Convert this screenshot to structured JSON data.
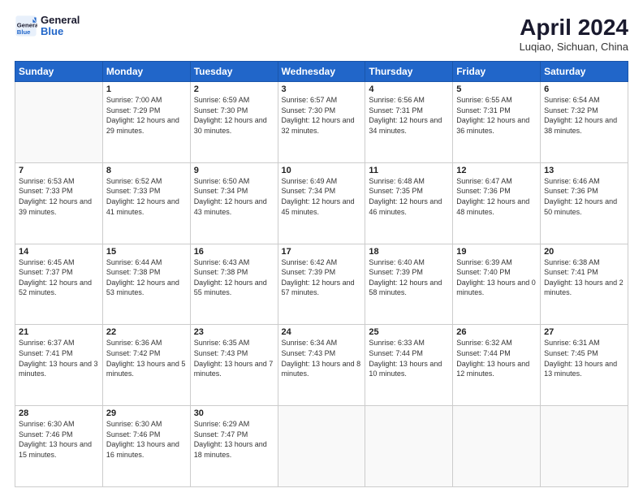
{
  "header": {
    "logo_line1": "General",
    "logo_line2": "Blue",
    "title": "April 2024",
    "subtitle": "Luqiao, Sichuan, China"
  },
  "weekdays": [
    "Sunday",
    "Monday",
    "Tuesday",
    "Wednesday",
    "Thursday",
    "Friday",
    "Saturday"
  ],
  "weeks": [
    [
      {
        "day": "",
        "sunrise": "",
        "sunset": "",
        "daylight": ""
      },
      {
        "day": "1",
        "sunrise": "7:00 AM",
        "sunset": "7:29 PM",
        "daylight": "12 hours and 29 minutes."
      },
      {
        "day": "2",
        "sunrise": "6:59 AM",
        "sunset": "7:30 PM",
        "daylight": "12 hours and 30 minutes."
      },
      {
        "day": "3",
        "sunrise": "6:57 AM",
        "sunset": "7:30 PM",
        "daylight": "12 hours and 32 minutes."
      },
      {
        "day": "4",
        "sunrise": "6:56 AM",
        "sunset": "7:31 PM",
        "daylight": "12 hours and 34 minutes."
      },
      {
        "day": "5",
        "sunrise": "6:55 AM",
        "sunset": "7:31 PM",
        "daylight": "12 hours and 36 minutes."
      },
      {
        "day": "6",
        "sunrise": "6:54 AM",
        "sunset": "7:32 PM",
        "daylight": "12 hours and 38 minutes."
      }
    ],
    [
      {
        "day": "7",
        "sunrise": "6:53 AM",
        "sunset": "7:33 PM",
        "daylight": "12 hours and 39 minutes."
      },
      {
        "day": "8",
        "sunrise": "6:52 AM",
        "sunset": "7:33 PM",
        "daylight": "12 hours and 41 minutes."
      },
      {
        "day": "9",
        "sunrise": "6:50 AM",
        "sunset": "7:34 PM",
        "daylight": "12 hours and 43 minutes."
      },
      {
        "day": "10",
        "sunrise": "6:49 AM",
        "sunset": "7:34 PM",
        "daylight": "12 hours and 45 minutes."
      },
      {
        "day": "11",
        "sunrise": "6:48 AM",
        "sunset": "7:35 PM",
        "daylight": "12 hours and 46 minutes."
      },
      {
        "day": "12",
        "sunrise": "6:47 AM",
        "sunset": "7:36 PM",
        "daylight": "12 hours and 48 minutes."
      },
      {
        "day": "13",
        "sunrise": "6:46 AM",
        "sunset": "7:36 PM",
        "daylight": "12 hours and 50 minutes."
      }
    ],
    [
      {
        "day": "14",
        "sunrise": "6:45 AM",
        "sunset": "7:37 PM",
        "daylight": "12 hours and 52 minutes."
      },
      {
        "day": "15",
        "sunrise": "6:44 AM",
        "sunset": "7:38 PM",
        "daylight": "12 hours and 53 minutes."
      },
      {
        "day": "16",
        "sunrise": "6:43 AM",
        "sunset": "7:38 PM",
        "daylight": "12 hours and 55 minutes."
      },
      {
        "day": "17",
        "sunrise": "6:42 AM",
        "sunset": "7:39 PM",
        "daylight": "12 hours and 57 minutes."
      },
      {
        "day": "18",
        "sunrise": "6:40 AM",
        "sunset": "7:39 PM",
        "daylight": "12 hours and 58 minutes."
      },
      {
        "day": "19",
        "sunrise": "6:39 AM",
        "sunset": "7:40 PM",
        "daylight": "13 hours and 0 minutes."
      },
      {
        "day": "20",
        "sunrise": "6:38 AM",
        "sunset": "7:41 PM",
        "daylight": "13 hours and 2 minutes."
      }
    ],
    [
      {
        "day": "21",
        "sunrise": "6:37 AM",
        "sunset": "7:41 PM",
        "daylight": "13 hours and 3 minutes."
      },
      {
        "day": "22",
        "sunrise": "6:36 AM",
        "sunset": "7:42 PM",
        "daylight": "13 hours and 5 minutes."
      },
      {
        "day": "23",
        "sunrise": "6:35 AM",
        "sunset": "7:43 PM",
        "daylight": "13 hours and 7 minutes."
      },
      {
        "day": "24",
        "sunrise": "6:34 AM",
        "sunset": "7:43 PM",
        "daylight": "13 hours and 8 minutes."
      },
      {
        "day": "25",
        "sunrise": "6:33 AM",
        "sunset": "7:44 PM",
        "daylight": "13 hours and 10 minutes."
      },
      {
        "day": "26",
        "sunrise": "6:32 AM",
        "sunset": "7:44 PM",
        "daylight": "13 hours and 12 minutes."
      },
      {
        "day": "27",
        "sunrise": "6:31 AM",
        "sunset": "7:45 PM",
        "daylight": "13 hours and 13 minutes."
      }
    ],
    [
      {
        "day": "28",
        "sunrise": "6:30 AM",
        "sunset": "7:46 PM",
        "daylight": "13 hours and 15 minutes."
      },
      {
        "day": "29",
        "sunrise": "6:30 AM",
        "sunset": "7:46 PM",
        "daylight": "13 hours and 16 minutes."
      },
      {
        "day": "30",
        "sunrise": "6:29 AM",
        "sunset": "7:47 PM",
        "daylight": "13 hours and 18 minutes."
      },
      {
        "day": "",
        "sunrise": "",
        "sunset": "",
        "daylight": ""
      },
      {
        "day": "",
        "sunrise": "",
        "sunset": "",
        "daylight": ""
      },
      {
        "day": "",
        "sunrise": "",
        "sunset": "",
        "daylight": ""
      },
      {
        "day": "",
        "sunrise": "",
        "sunset": "",
        "daylight": ""
      }
    ]
  ]
}
